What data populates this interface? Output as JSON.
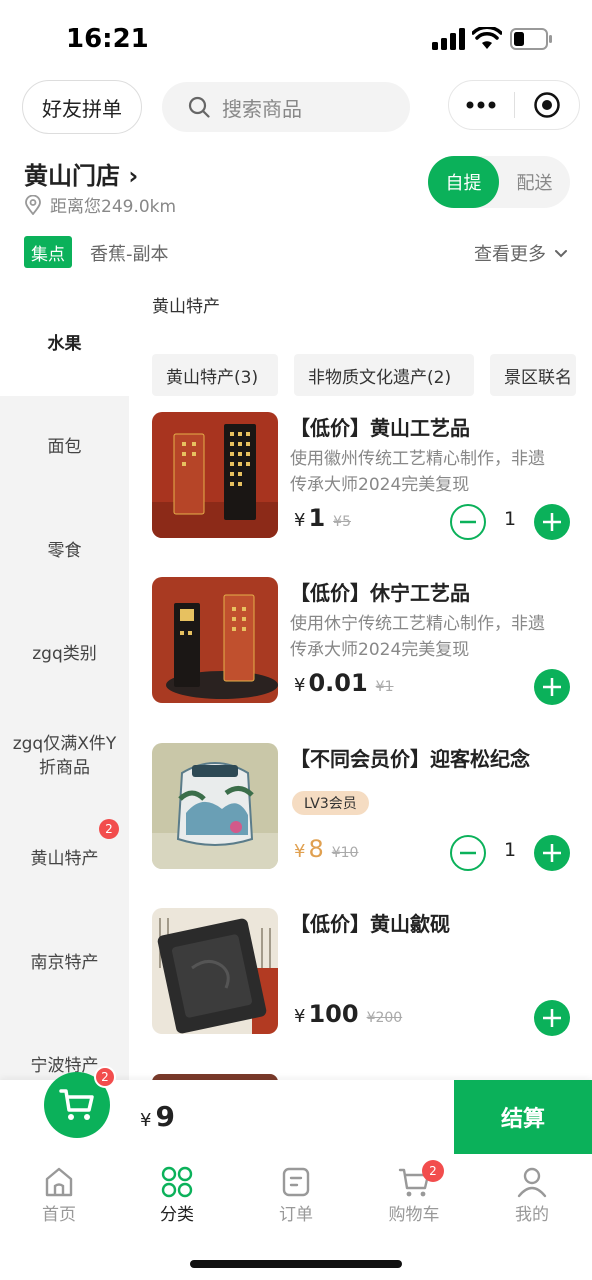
{
  "status": {
    "time": "16:21"
  },
  "header": {
    "friend_btn": "好友拼单",
    "search_placeholder": "搜索商品"
  },
  "store": {
    "name": "黄山门店 ›",
    "distance": "距离您249.0km",
    "modes": [
      "自提",
      "配送"
    ],
    "active_mode": "自提"
  },
  "tags": {
    "green": "集点",
    "text": "香蕉-副本",
    "view_more": "查看更多"
  },
  "sidebar": {
    "items": [
      {
        "label": "水果",
        "active": true
      },
      {
        "label": "面包"
      },
      {
        "label": "零食"
      },
      {
        "label": "zgq类别"
      },
      {
        "label": "zgq仅满X件Y折商品"
      },
      {
        "label": "黄山特产",
        "badge": "2"
      },
      {
        "label": "南京特产"
      },
      {
        "label": "宁波特产"
      }
    ]
  },
  "main": {
    "section_title": "黄山特产",
    "chips": [
      "黄山特产(3)",
      "非物质文化遗产(2)",
      "景区联名"
    ],
    "products": [
      {
        "name": "【低价】黄山工艺品",
        "desc": "使用徽州传统工艺精心制作，非遗传承大师2024完美复现",
        "currency": "¥",
        "price": "1",
        "orig": "¥5",
        "qty": "1"
      },
      {
        "name": "【低价】休宁工艺品",
        "desc": "使用休宁传统工艺精心制作，非遗传承大师2024完美复现",
        "currency": "¥",
        "price": "0.01",
        "orig": "¥1"
      },
      {
        "name": "【不同会员价】迎客松纪念",
        "badge": "LV3会员",
        "currency": "¥",
        "price": "8",
        "orig": "¥10",
        "qty": "1"
      },
      {
        "name": "【低价】黄山歙砚",
        "currency": "¥",
        "price": "100",
        "orig": "¥200"
      }
    ]
  },
  "cart": {
    "badge": "2",
    "currency": "¥",
    "total": "9",
    "checkout": "结算"
  },
  "tabbar": {
    "tabs": [
      {
        "label": "首页"
      },
      {
        "label": "分类",
        "active": true
      },
      {
        "label": "订单"
      },
      {
        "label": "购物车",
        "badge": "2"
      },
      {
        "label": "我的"
      }
    ]
  },
  "colors": {
    "accent": "#0bb15a",
    "badge": "#f24d4d",
    "member_price": "#e0a050"
  }
}
